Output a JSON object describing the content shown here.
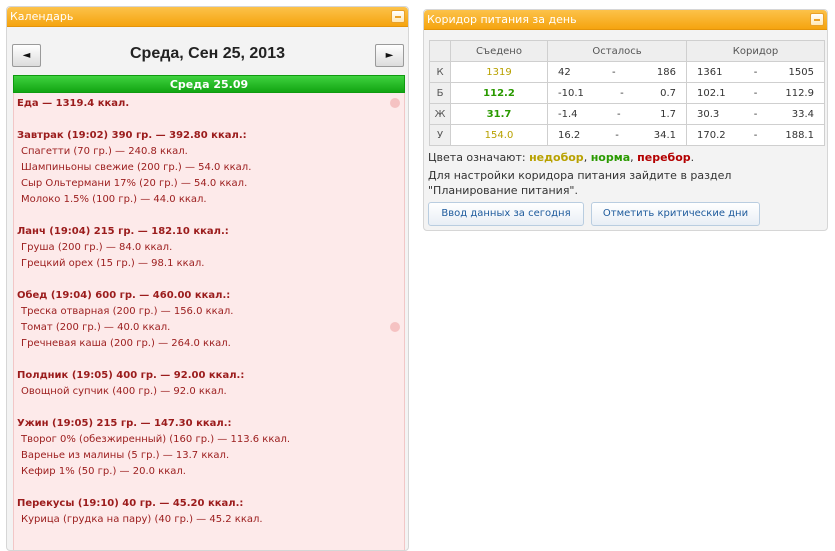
{
  "calendar": {
    "title": "Календарь",
    "prev_label": "◄",
    "next_label": "►",
    "day_title": "Среда, Сен 25, 2013",
    "day_bar": "Среда 25.09",
    "lines": [
      {
        "type": "bold",
        "text": "Еда — 1319.4 ккал."
      },
      {
        "type": "gap",
        "text": ""
      },
      {
        "type": "bold",
        "text": "Завтрак (19:02) 390 гр. — 392.80 ккал.:"
      },
      {
        "type": "item",
        "text": "Спагетти (70 гр.) — 240.8 ккал."
      },
      {
        "type": "item",
        "text": "Шампиньоны свежие (200 гр.) — 54.0 ккал."
      },
      {
        "type": "item",
        "text": "Сыр Ольтермани 17% (20 гр.) — 54.0 ккал."
      },
      {
        "type": "item",
        "text": "Молоко 1.5% (100 гр.) — 44.0 ккал."
      },
      {
        "type": "gap",
        "text": ""
      },
      {
        "type": "bold",
        "text": "Ланч (19:04) 215 гр. — 182.10 ккал.:"
      },
      {
        "type": "item",
        "text": "Груша (200 гр.) — 84.0 ккал."
      },
      {
        "type": "item",
        "text": "Грецкий орех (15 гр.) — 98.1 ккал."
      },
      {
        "type": "gap",
        "text": ""
      },
      {
        "type": "bold",
        "text": "Обед (19:04) 600 гр. — 460.00 ккал.:"
      },
      {
        "type": "item",
        "text": "Треска отварная (200 гр.) — 156.0 ккал."
      },
      {
        "type": "item",
        "text": "Томат (200 гр.) — 40.0 ккал."
      },
      {
        "type": "item",
        "text": "Гречневая каша (200 гр.) — 264.0 ккал."
      },
      {
        "type": "gap",
        "text": ""
      },
      {
        "type": "bold",
        "text": "Полдник (19:05) 400 гр. — 92.00 ккал.:"
      },
      {
        "type": "item",
        "text": "Овощной супчик (400 гр.) — 92.0 ккал."
      },
      {
        "type": "gap",
        "text": ""
      },
      {
        "type": "bold",
        "text": "Ужин (19:05) 215 гр. — 147.30 ккал.:"
      },
      {
        "type": "item",
        "text": "Творог 0% (обезжиренный) (160 гр.) — 113.6 ккал."
      },
      {
        "type": "item",
        "text": "Варенье из малины (5 гр.) — 13.7 ккал."
      },
      {
        "type": "item",
        "text": "Кефир 1% (50 гр.) — 20.0 ккал."
      },
      {
        "type": "gap",
        "text": ""
      },
      {
        "type": "bold",
        "text": "Перекусы (19:10) 40 гр. — 45.20 ккал.:"
      },
      {
        "type": "item",
        "text": "Курица (грудка на пару) (40 гр.) — 45.2 ккал."
      }
    ]
  },
  "corridor": {
    "title": "Коридор питания за день",
    "headers": [
      "",
      "Съедено",
      "Осталось",
      "Коридор"
    ],
    "rows": [
      {
        "label": "К",
        "eaten": "1319",
        "status": "yellow",
        "left_min": "42",
        "left_max": "186",
        "cor_min": "1361",
        "cor_max": "1505"
      },
      {
        "label": "Б",
        "eaten": "112.2",
        "status": "green",
        "left_min": "-10.1",
        "left_max": "0.7",
        "cor_min": "102.1",
        "cor_max": "112.9"
      },
      {
        "label": "Ж",
        "eaten": "31.7",
        "status": "green",
        "left_min": "-1.4",
        "left_max": "1.7",
        "cor_min": "30.3",
        "cor_max": "33.4"
      },
      {
        "label": "У",
        "eaten": "154.0",
        "status": "yellow",
        "left_min": "16.2",
        "left_max": "34.1",
        "cor_min": "170.2",
        "cor_max": "188.1"
      }
    ],
    "dash": "-",
    "legend_prefix": "Цвета означают:",
    "legend_low": "недобор",
    "legend_ok": "норма",
    "legend_over": "перебор",
    "legend_sep": ",",
    "legend_end": ".",
    "hint": "Для настройки коридора питания зайдите в раздел \"Планирование питания\".",
    "btn_today": "Ввод данных за сегодня",
    "btn_critical": "Отметить критические дни"
  },
  "colors": {
    "header": "#f5a40f",
    "green_bar": "#12a512",
    "list_bg": "#fdeaea",
    "text_red": "#9b1c1c",
    "status_yellow": "#b8a100",
    "status_green": "#2a9a00",
    "status_red": "#b30000"
  }
}
